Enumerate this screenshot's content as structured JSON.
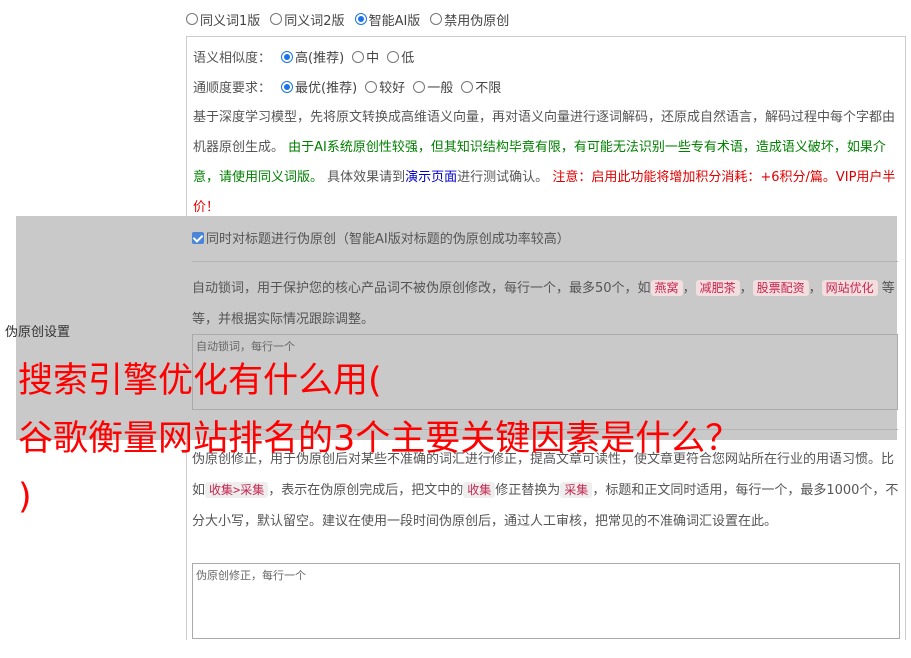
{
  "version_options": [
    {
      "label": "同义词1版",
      "checked": false
    },
    {
      "label": "同义词2版",
      "checked": false
    },
    {
      "label": "智能AI版",
      "checked": true
    },
    {
      "label": "禁用伪原创",
      "checked": false
    }
  ],
  "similarity": {
    "label": "语义相似度：",
    "options": [
      {
        "label": "高(推荐)",
        "checked": true
      },
      {
        "label": "中",
        "checked": false
      },
      {
        "label": "低",
        "checked": false
      }
    ]
  },
  "fluency": {
    "label": "通顺度要求：",
    "options": [
      {
        "label": "最优(推荐)",
        "checked": true
      },
      {
        "label": "较好",
        "checked": false
      },
      {
        "label": "一般",
        "checked": false
      },
      {
        "label": "不限",
        "checked": false
      }
    ]
  },
  "description": {
    "intro": "基于深度学习模型，先将原文转换成高维语义向量，再对语义向量进行逐词解码，还原成自然语言，解码过程中每个字都由机器原创生成。 ",
    "warning_green": "由于AI系统原创性较强，但其知识结构毕竟有限，有可能无法识别一些专有术语，造成语义破坏，如果介意，请使用同义词版。",
    "effect_prefix": " 具体效果请到",
    "demo_link": "演示页面",
    "effect_suffix": "进行测试确认。 ",
    "notice_red": "注意：启用此功能将增加积分消耗：+6积分/篇。VIP用户半价！"
  },
  "title_option": {
    "label": "同时对标题进行伪原创（智能AI版对标题的伪原创成功率较高）",
    "checked": true
  },
  "lock_words": {
    "text_before": "自动锁词，用于保护您的核心产品词不被伪原创修改，每行一个，最多50个，如",
    "examples": [
      "燕窝",
      "减肥茶",
      "股票配资",
      "网站优化"
    ],
    "sep": "，",
    "text_after": "等等，并根据实际情况跟踪调整。",
    "placeholder": "自动锁词，每行一个"
  },
  "side_label": "伪原创设置",
  "correction": {
    "text1": "伪原创修正，用于伪原创后对某些不准确的词汇进行修正，提高文章可读性，使文章更符合您网站所在行业的用语习惯。比如",
    "example1": "收集>采集",
    "text2": "，表示在伪原创完成后，把文中的",
    "example2": "收集",
    "text3": "修正替换为",
    "example3": "采集",
    "text4": "，标题和正文同时适用，每行一个，最多1000个，不分大小写，默认留空。建议在使用一段时间伪原创后，通过人工审核，把常见的不准确词汇设置在此。",
    "placeholder": "伪原创修正，每行一个"
  },
  "banner": {
    "line1": "搜索引擎优化有什么用(",
    "line2": "谷歌衡量网站排名的3个主要关键因素是什么？",
    "line3": ")"
  }
}
